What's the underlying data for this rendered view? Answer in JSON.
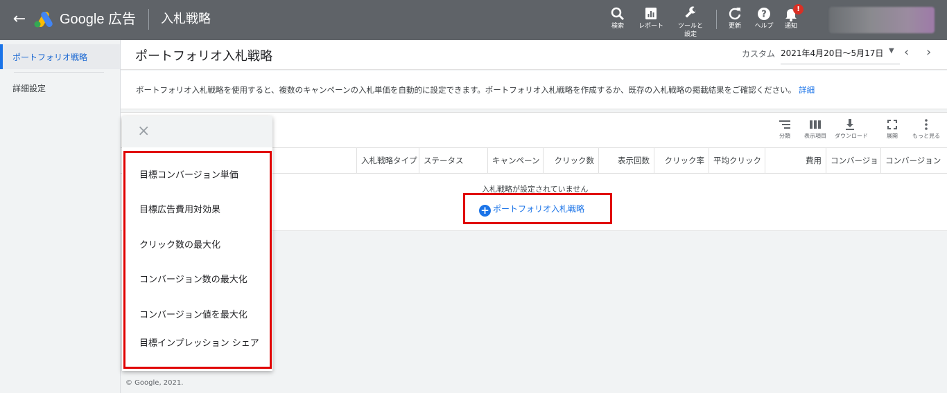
{
  "app": {
    "back_icon": "arrow-left-icon",
    "brand": "Google 広告",
    "page_name": "入札戦略"
  },
  "toolbar": {
    "search": "検索",
    "reports": "レポート",
    "tools": "ツールと設定",
    "refresh": "更新",
    "help": "ヘルプ",
    "notifications": "通知",
    "notification_badge": "!"
  },
  "sidebar": {
    "items": [
      {
        "label": "ポートフォリオ戦略",
        "active": true
      },
      {
        "label": "詳細設定",
        "active": false
      }
    ]
  },
  "header": {
    "title": "ポートフォリオ入札戦略",
    "date_label": "カスタム",
    "date_range": "2021年4月20日～5月17日",
    "prev": "‹",
    "next": "›"
  },
  "info": {
    "text": "ポートフォリオ入札戦略を使用すると、複数のキャンペーンの入札単価を自動的に設定できます。ポートフォリオ入札戦略を作成するか、既存の入札戦略の掲載結果をご確認ください。",
    "link": "詳細"
  },
  "table_tools": {
    "segment": "分類",
    "columns": "表示項目",
    "download": "ダウンロード",
    "expand": "展開",
    "more": "もっと見る"
  },
  "table": {
    "columns": [
      "入札戦略タイプ",
      "ステータス",
      "キャンペーン",
      "クリック数",
      "表示回数",
      "クリック率",
      "平均クリック",
      "費用",
      "コンバージョ",
      "コンバージョン"
    ],
    "empty_message": "入札戦略が設定されていません",
    "add_label": "ポートフォリオ入札戦略"
  },
  "menu": {
    "close": "×",
    "items": [
      "目標コンバージョン単価",
      "目標広告費用対効果",
      "クリック数の最大化",
      "コンバージョン数の最大化",
      "コンバージョン値を最大化",
      "目標インプレッション シェア"
    ]
  },
  "footer": "© Google, 2021.",
  "colors": {
    "topbar": "#5f6368",
    "accent": "#1a73e8",
    "highlight": "#e00000"
  }
}
